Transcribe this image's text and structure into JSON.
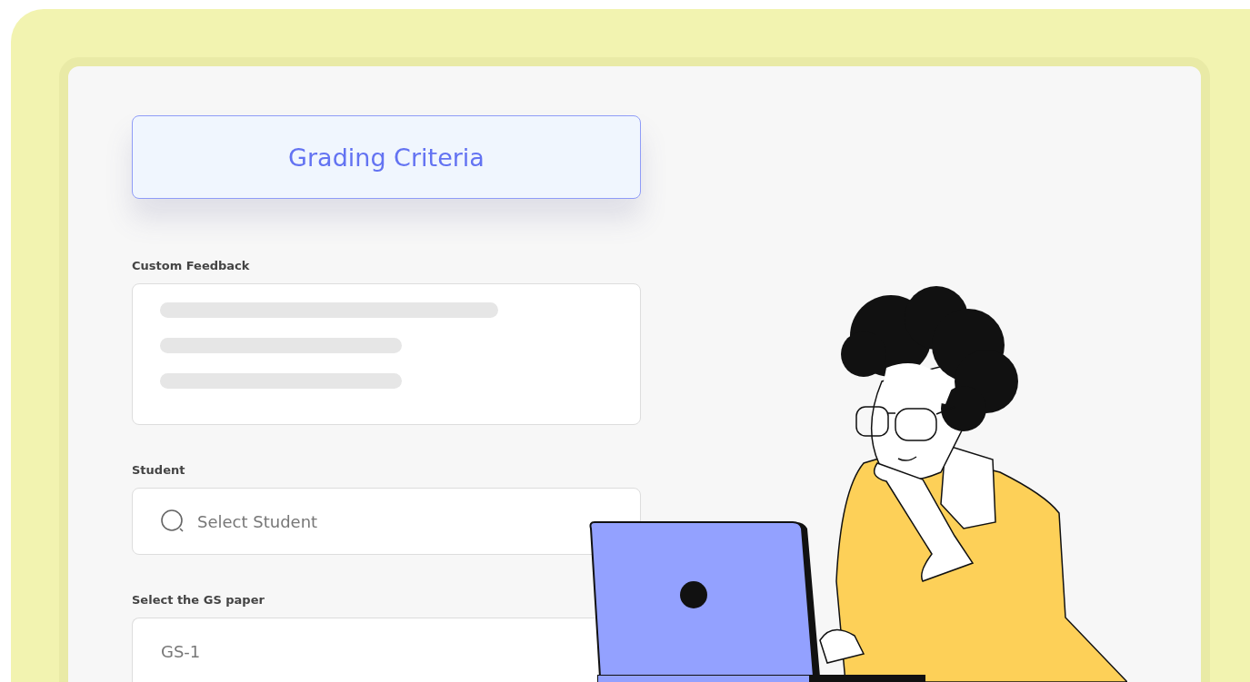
{
  "heading": "Grading Criteria",
  "fields": [
    {
      "kind": "textarea",
      "label": "Custom Feedback"
    },
    {
      "kind": "search",
      "label": "Student",
      "placeholder": "Select Student"
    },
    {
      "kind": "select",
      "label": "Select the GS paper",
      "value": "GS-1"
    }
  ]
}
